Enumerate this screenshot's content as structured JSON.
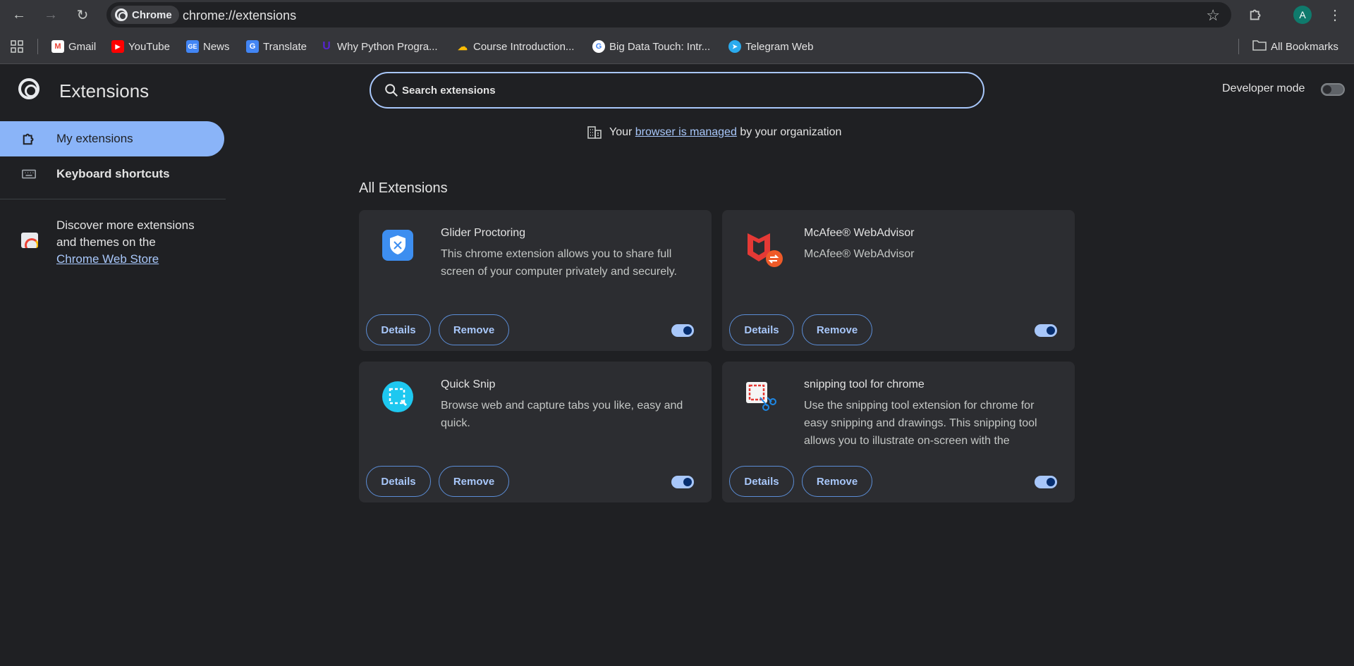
{
  "browser": {
    "chip_label": "Chrome",
    "url": "chrome://extensions",
    "avatar_letter": "A"
  },
  "bookmarks": [
    {
      "label": "Gmail",
      "icon": "gmail-icon"
    },
    {
      "label": "YouTube",
      "icon": "youtube-icon"
    },
    {
      "label": "News",
      "icon": "news-icon"
    },
    {
      "label": "Translate",
      "icon": "translate-icon"
    },
    {
      "label": "Why Python Progra...",
      "icon": "udemy-icon"
    },
    {
      "label": "Course Introduction...",
      "icon": "google-cloud-icon"
    },
    {
      "label": "Big Data Touch: Intr...",
      "icon": "google-icon"
    },
    {
      "label": "Telegram Web",
      "icon": "telegram-icon"
    }
  ],
  "all_bookmarks_label": "All Bookmarks",
  "page": {
    "title": "Extensions",
    "search_placeholder": "Search extensions",
    "developer_mode_label": "Developer mode",
    "managed": {
      "prefix": "Your",
      "link": "browser is managed",
      "suffix": "by your organization"
    },
    "section_title": "All Extensions"
  },
  "sidebar": {
    "items": [
      {
        "label": "My extensions"
      },
      {
        "label": "Keyboard shortcuts"
      }
    ],
    "discover_text": "Discover more extensions and themes on the",
    "discover_link": "Chrome Web Store"
  },
  "extensions": [
    {
      "name": "Glider Proctoring",
      "description": "This chrome extension allows you to share full screen of your computer privately and securely.",
      "details_label": "Details",
      "remove_label": "Remove",
      "enabled": true
    },
    {
      "name": "McAfee® WebAdvisor",
      "description": "McAfee® WebAdvisor",
      "details_label": "Details",
      "remove_label": "Remove",
      "enabled": true
    },
    {
      "name": "Quick Snip",
      "description": "Browse web and capture tabs you like, easy and quick.",
      "details_label": "Details",
      "remove_label": "Remove",
      "enabled": true
    },
    {
      "name": "snipping tool for chrome",
      "description": "Use the snipping tool extension for chrome for easy snipping and drawings. This snipping tool allows you to illustrate on-screen with the",
      "details_label": "Details",
      "remove_label": "Remove",
      "enabled": true
    }
  ],
  "colors": {
    "accent": "#8ab4f8",
    "background": "#1f2023",
    "card": "#2c2d31"
  }
}
